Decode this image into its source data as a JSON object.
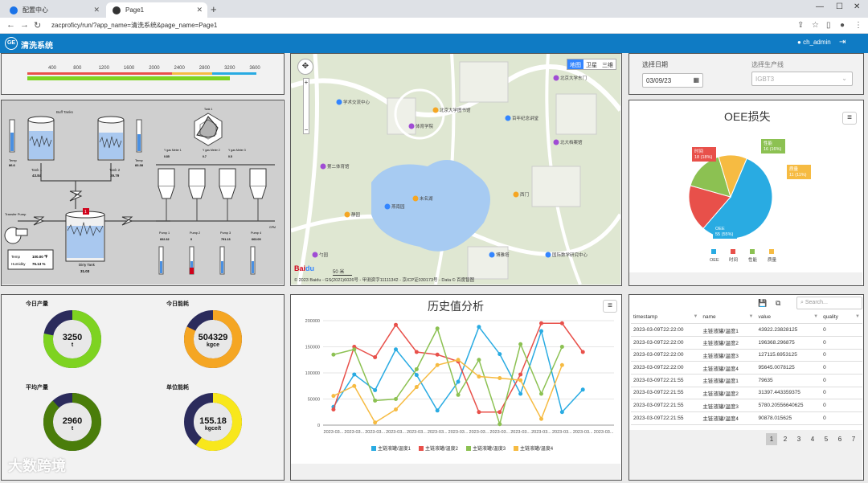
{
  "browser": {
    "tabs": [
      {
        "label": "配置中心",
        "active": false
      },
      {
        "label": "Page1",
        "active": true
      }
    ],
    "url": "zacproficy/run/?app_name=清洗系统&page_name=Page1"
  },
  "app": {
    "title": "清洗系统",
    "logo": "GE",
    "user": "ch_admin"
  },
  "gauge": {
    "ticks": [
      "400",
      "800",
      "1200",
      "1600",
      "2000",
      "2400",
      "2800",
      "3200",
      "3600"
    ]
  },
  "scada": {
    "buffer_tanks": {
      "title": "Buff Tanks",
      "tank1": "Tank 1",
      "tank1_val": "43.84",
      "tank2": "Tank 2",
      "tank2_val": "39.79"
    },
    "temp_left": {
      "label": "Temp",
      "val": "86.6"
    },
    "temp_right": {
      "label": "Temp",
      "val": "83.38"
    },
    "transfer_pump": "Transfer Pump",
    "dirty_tank": {
      "label": "Dirty Tank",
      "val": "31.03",
      "badge": "1"
    },
    "readout": {
      "temp_label": "Temp",
      "temp_val": "100.00 ℉",
      "hum_label": "Humidity",
      "hum_val": "76.13 %"
    },
    "radar": {
      "title": "Tank 1",
      "labels": [
        "Ambient Humidity",
        "Ambient Temp",
        "Flow Meter 1",
        "Flow Meter 2",
        "Flow Meter 3",
        "Flow Meter 4"
      ]
    },
    "valves": [
      {
        "label": "Y gas Meter 1",
        "val": "0.85"
      },
      {
        "label": "Y gas Meter 2",
        "val": "0.7"
      },
      {
        "label": "Y gas Meter 3",
        "val": "0.5"
      }
    ],
    "alert_badge": "3",
    "pumps": [
      {
        "label": "Pump 1",
        "val": "602.32"
      },
      {
        "label": "Pump 2",
        "val": "0"
      },
      {
        "label": "Pump 3",
        "val": "791.13"
      },
      {
        "label": "Pump 4",
        "val": "663.09"
      }
    ],
    "gpm": "GPM"
  },
  "map": {
    "types": [
      "地图",
      "卫星",
      "三维"
    ],
    "pois": [
      "学术交流中心",
      "体育学院",
      "北京大学图书馆",
      "百年纪念讲堂",
      "北京大学东门",
      "未名湖",
      "博雅塔",
      "第二体育馆",
      "静园",
      "燕南园",
      "勺园",
      "西门",
      "国际数学研究中心",
      "北大档案馆"
    ],
    "scale": "50 米",
    "copyright": "© 2023 Baidu - GS(2021)6026号 - 甲测资字11111342 - 京ICP证030173号 - Data © 百度智图"
  },
  "filters": {
    "date_label": "选择日期",
    "date_value": "03/09/23",
    "line_label": "选择生产线",
    "line_value": "IGBT3"
  },
  "oee": {
    "title": "OEE损失",
    "chart_data": {
      "type": "pie",
      "title": "OEE损失",
      "slices": [
        {
          "name": "OEE",
          "value": 55,
          "pct": "55%",
          "color": "#29abe2"
        },
        {
          "name": "时间",
          "value": 18,
          "pct": "18%",
          "color": "#e8504a"
        },
        {
          "name": "性能",
          "value": 16,
          "pct": "16%",
          "color": "#8cc152"
        },
        {
          "name": "质量",
          "value": 11,
          "pct": "11%",
          "color": "#f6bb42"
        }
      ]
    },
    "labels": [
      "OEE\n55 (55%)",
      "时间\n18 (18%)",
      "性能\n16 (16%)",
      "质量\n11 (11%)"
    ]
  },
  "kpis": [
    {
      "label": "今日产量",
      "value": "3250",
      "unit": "t",
      "fill": 0.78,
      "color": "#7ed321",
      "track": "#2b2b5c"
    },
    {
      "label": "今日能耗",
      "value": "504329",
      "unit": "kgce",
      "fill": 0.82,
      "color": "#f5a623",
      "track": "#2b2b5c"
    },
    {
      "label": "平均产量",
      "value": "2960",
      "unit": "t",
      "fill": 0.88,
      "color": "#4a7d0a",
      "track": "#2b2b5c"
    },
    {
      "label": "单位能耗",
      "value": "155.18",
      "unit": "kgce/t",
      "fill": 0.6,
      "color": "#f8e71c",
      "track": "#2b2b5c"
    }
  ],
  "history": {
    "title": "历史值分析",
    "chart_data": {
      "type": "line",
      "title": "历史值分析",
      "categories": [
        "2023-03...",
        "2023-03...",
        "2023-03...",
        "2023-03...",
        "2023-03...",
        "2023-03...",
        "2023-03...",
        "2023-03...",
        "2023-03...",
        "2023-03...",
        "2023-03...",
        "2023-03...",
        "2023-03...",
        "2023-03..."
      ],
      "ylim": [
        0,
        200000
      ],
      "yticks": [
        "0",
        "50000",
        "100000",
        "150000",
        "200000"
      ],
      "series": [
        {
          "name": "主链液罐/温度1",
          "color": "#29abe2",
          "values": [
            35000,
            97000,
            67000,
            145000,
            96000,
            28000,
            83000,
            188000,
            136000,
            60000,
            180000,
            25000,
            68000
          ]
        },
        {
          "name": "主链液罐/温度2",
          "color": "#e8504a",
          "values": [
            30000,
            150000,
            130000,
            192000,
            140000,
            135000,
            122000,
            25000,
            25000,
            97000,
            195000,
            195000,
            140000
          ]
        },
        {
          "name": "主链液罐/温度3",
          "color": "#8cc152",
          "values": [
            135000,
            145000,
            47000,
            50000,
            107000,
            185000,
            58000,
            125000,
            2000,
            155000,
            60000,
            150000
          ]
        },
        {
          "name": "主链液罐/温度4",
          "color": "#f6bb42",
          "values": [
            56000,
            75000,
            5000,
            30000,
            73000,
            115000,
            125000,
            93000,
            90000,
            86000,
            12000,
            115000
          ]
        }
      ]
    }
  },
  "table": {
    "search_placeholder": "Search...",
    "columns": [
      "timestamp",
      "name",
      "value",
      "quality"
    ],
    "rows": [
      [
        "2023-03-09T22:22:00",
        "主链液罐/温度1",
        "43922.23828125",
        "0"
      ],
      [
        "2023-03-09T22:22:00",
        "主链液罐/温度2",
        "196368.296875",
        "0"
      ],
      [
        "2023-03-09T22:22:00",
        "主链液罐/温度3",
        "127115.6953125",
        "0"
      ],
      [
        "2023-03-09T22:22:00",
        "主链液罐/温度4",
        "95645.0078125",
        "0"
      ],
      [
        "2023-03-09T22:21:55",
        "主链液罐/温度1",
        "79635",
        "0"
      ],
      [
        "2023-03-09T22:21:55",
        "主链液罐/温度2",
        "31397.443359375",
        "0"
      ],
      [
        "2023-03-09T22:21:55",
        "主链液罐/温度3",
        "5780.20556640625",
        "0"
      ],
      [
        "2023-03-09T22:21:55",
        "主链液罐/温度4",
        "90878.015625",
        "0"
      ]
    ],
    "pages": [
      "1",
      "2",
      "3",
      "4",
      "5",
      "6",
      "7"
    ]
  },
  "watermark": "大数跨境"
}
